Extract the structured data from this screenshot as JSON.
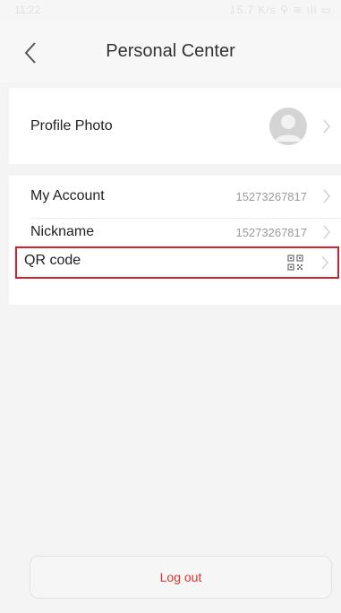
{
  "status": {
    "time": "11:22",
    "right": "15.7 K/s ⚲ ≋ ıll ▭"
  },
  "nav": {
    "title": "Personal Center"
  },
  "profile": {
    "label": "Profile Photo"
  },
  "account": {
    "label": "My Account",
    "value": "15273267817"
  },
  "nickname": {
    "label": "Nickname",
    "value": "15273267817"
  },
  "qr": {
    "label": "QR code"
  },
  "logout": {
    "label": "Log out"
  },
  "colors": {
    "accent": "#d9302f",
    "highlight": "#d8202a",
    "background": "#f4f4f4"
  },
  "icons": {
    "back": "chevron-left-icon",
    "avatar": "avatar-placeholder-icon",
    "chevron": "chevron-right-icon",
    "qr": "qr-code-icon"
  }
}
